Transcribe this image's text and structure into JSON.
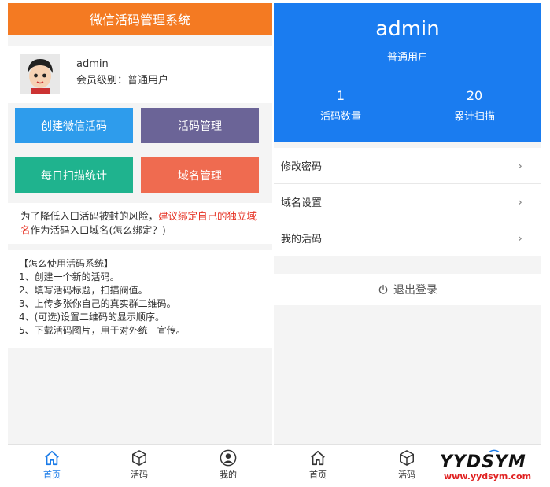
{
  "left": {
    "header_title": "微信活码管理系统",
    "profile": {
      "name": "admin",
      "level": "会员级别：普通用户"
    },
    "tiles": [
      {
        "label": "创建微信活码"
      },
      {
        "label": "活码管理"
      },
      {
        "label": "每日扫描统计"
      },
      {
        "label": "域名管理"
      }
    ],
    "notice": {
      "text_1": "为了降低入口活码被封的风险，",
      "text_red": "建议绑定自己的独立域名",
      "text_2": "作为活码入口域名(怎么绑定？)"
    },
    "howto": {
      "title": "【怎么使用活码系统】",
      "steps": [
        "1、创建一个新的活码。",
        "2、填写活码标题，扫描阀值。",
        "3、上传多张你自己的真实群二维码。",
        "4、(可选)设置二维码的显示顺序。",
        "5、下载活码图片，用于对外统一宣传。"
      ]
    },
    "tabs": [
      {
        "label": "首页",
        "icon": "home-icon"
      },
      {
        "label": "活码",
        "icon": "cube-icon"
      },
      {
        "label": "我的",
        "icon": "user-icon"
      }
    ]
  },
  "right": {
    "username": "admin",
    "role": "普通用户",
    "stats": [
      {
        "value": "1",
        "label": "活码数量"
      },
      {
        "value": "20",
        "label": "累计扫描"
      }
    ],
    "menu": [
      {
        "label": "修改密码"
      },
      {
        "label": "域名设置"
      },
      {
        "label": "我的活码"
      }
    ],
    "logout": "退出登录",
    "tabs": [
      {
        "label": "首页",
        "icon": "home-icon"
      },
      {
        "label": "活码",
        "icon": "cube-icon"
      }
    ]
  },
  "watermark": {
    "brand": "YYDSYM",
    "url": "www.yydsym.com"
  },
  "colors": {
    "header_orange": "#f47a22",
    "profile_blue": "#1a7cf0",
    "tile_blue": "#2e9cec",
    "tile_purple": "#6b6497",
    "tile_green": "#1fb38e",
    "tile_coral": "#ef6b50",
    "active_tab": "#1a7be8",
    "warning_red": "#e63325"
  }
}
